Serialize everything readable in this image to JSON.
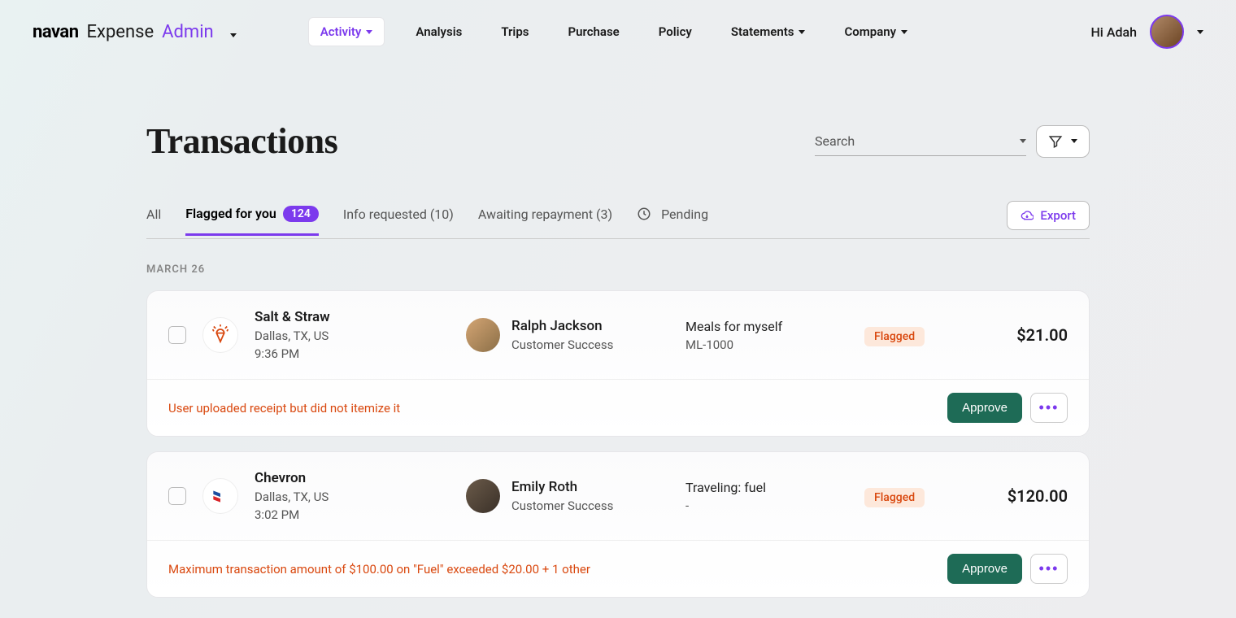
{
  "header": {
    "brand_navan": "navan",
    "brand_expense": "Expense",
    "brand_admin": "Admin",
    "greeting": "Hi Adah"
  },
  "nav": {
    "activity": "Activity",
    "analysis": "Analysis",
    "trips": "Trips",
    "purchase": "Purchase",
    "policy": "Policy",
    "statements": "Statements",
    "company": "Company"
  },
  "page": {
    "title": "Transactions",
    "search_placeholder": "Search",
    "export_label": "Export"
  },
  "tabs": {
    "all": "All",
    "flagged": "Flagged for you",
    "flagged_count": "124",
    "info": "Info requested (10)",
    "awaiting": "Awaiting repayment (3)",
    "pending": "Pending"
  },
  "date_group": "MARCH 26",
  "transactions": [
    {
      "merchant": "Salt & Straw",
      "location": "Dallas, TX, US",
      "time": "9:36 PM",
      "user_name": "Ralph Jackson",
      "user_role": "Customer Success",
      "category": "Meals for myself",
      "code": "ML-1000",
      "status": "Flagged",
      "amount": "$21.00",
      "warning": "User uploaded receipt but did not itemize it",
      "approve_label": "Approve"
    },
    {
      "merchant": "Chevron",
      "location": "Dallas, TX, US",
      "time": "3:02 PM",
      "user_name": "Emily Roth",
      "user_role": "Customer Success",
      "category": "Traveling: fuel",
      "code": "-",
      "status": "Flagged",
      "amount": "$120.00",
      "warning": "Maximum transaction amount of $100.00 on \"Fuel\" exceeded $20.00 + 1 other",
      "approve_label": "Approve"
    }
  ]
}
